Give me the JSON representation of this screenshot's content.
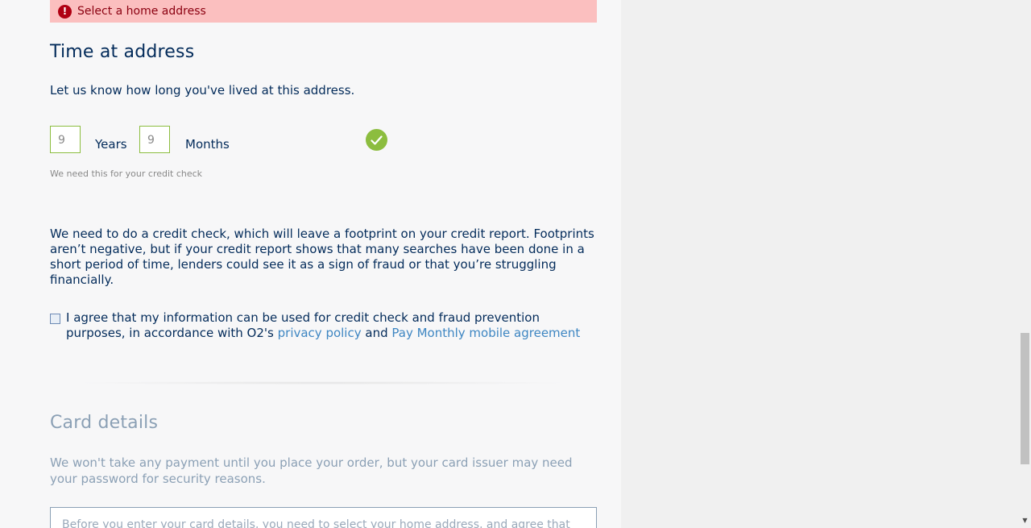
{
  "error": {
    "icon": "exclamation-icon",
    "message": "Select a home address"
  },
  "time_at_address": {
    "title": "Time at address",
    "intro": "Let us know how long you've lived at this address.",
    "years_value": "9",
    "years_label": "Years",
    "months_value": "9",
    "months_label": "Months",
    "valid_icon": "checkmark-icon",
    "hint": "We need this for your credit check"
  },
  "credit_check": {
    "paragraph": "We need to do a credit check, which will leave a footprint on your credit report. Footprints aren’t negative, but if your credit report shows that many searches have been done in a short period of time, lenders could see it as a sign of fraud or that you’re struggling financially.",
    "agree_text_before": "I agree that my information can be used for credit check and fraud prevention purposes, in accordance with O2's ",
    "privacy_link": "privacy policy",
    "and_text": " and ",
    "agreement_link": "Pay Monthly mobile agreement",
    "checked": false
  },
  "card_details": {
    "title": "Card details",
    "intro": "We won't take any payment until you place your order, but your card issuer may need your password for security reasons.",
    "notice": "Before you enter your card details, you need to select your home address, and agree that"
  },
  "colors": {
    "primary_text": "#032b5a",
    "link": "#3e86c2",
    "success": "#8cbd3f",
    "error_bg": "#fbbfbf",
    "error_icon": "#b00012"
  }
}
